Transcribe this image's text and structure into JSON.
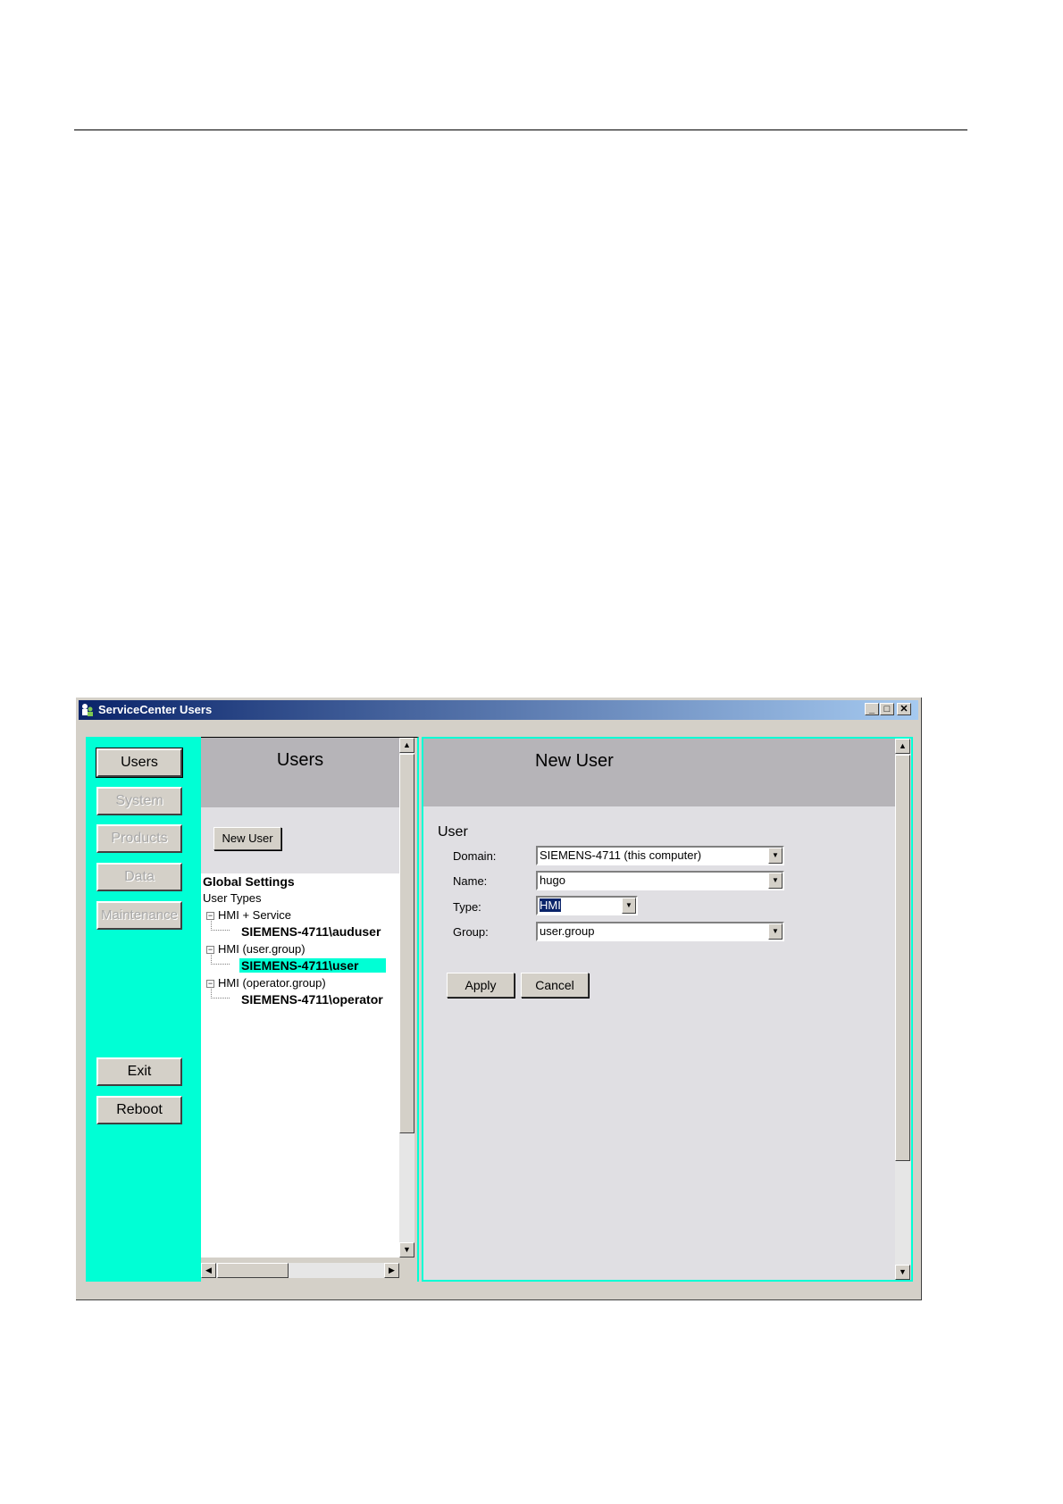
{
  "window": {
    "title": "ServiceCenter Users",
    "controls": {
      "minimize": "_",
      "maximize": "□",
      "close": "✕"
    }
  },
  "nav": {
    "users": "Users",
    "system": "System",
    "products": "Products",
    "data": "Data",
    "maintenance": "Maintenance",
    "exit": "Exit",
    "reboot": "Reboot"
  },
  "users_panel": {
    "title": "Users",
    "new_user_button": "New User",
    "tree": {
      "global_settings": "Global Settings",
      "user_types": "User Types",
      "groups": [
        {
          "label": "HMI + Service",
          "user": "SIEMENS-4711\\auduser"
        },
        {
          "label": "HMI (user.group)",
          "user": "SIEMENS-4711\\user"
        },
        {
          "label": "HMI (operator.group)",
          "user": "SIEMENS-4711\\operator"
        }
      ],
      "selected": "SIEMENS-4711\\user"
    }
  },
  "new_user_panel": {
    "title": "New User",
    "group_label": "User",
    "fields": {
      "domain_label": "Domain:",
      "domain_value": "SIEMENS-4711 (this computer)",
      "name_label": "Name:",
      "name_value": "hugo",
      "type_label": "Type:",
      "type_value": "HMI",
      "group_label": "Group:",
      "group_value": "user.group"
    },
    "apply_button": "Apply",
    "cancel_button": "Cancel"
  },
  "colors": {
    "accent": "#00ffd5",
    "title_bar": "#0a246a",
    "header_gray": "#b6b4b8",
    "panel_bg": "#e0dfe3"
  }
}
